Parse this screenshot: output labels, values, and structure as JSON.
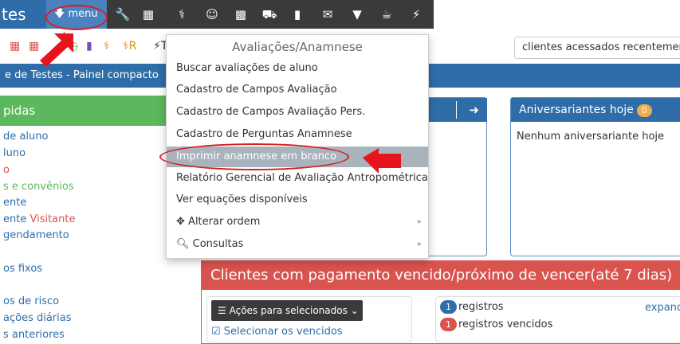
{
  "brand": {
    "title": "tes"
  },
  "topmenu": {
    "menu_label": "menu"
  },
  "row2": {
    "label_r": "R",
    "label_t": "T"
  },
  "search": {
    "value": "clientes acessados recentemente"
  },
  "bluebar": {
    "title": "e de Testes - Painel compacto"
  },
  "sidebar": {
    "header": "pidas",
    "items": [
      {
        "text": "de aluno",
        "color": "#2f6da8"
      },
      {
        "text": "luno",
        "color": "#2f6da8"
      },
      {
        "text": "o",
        "color": "#d9534f"
      },
      {
        "text": "s e convênios",
        "color": "#5cb85c"
      },
      {
        "text": "ente",
        "color": "#2f6da8"
      },
      {
        "text": "ente",
        "text2": "Visitante",
        "color": "#2f6da8",
        "color2": "#d9534f"
      },
      {
        "text": "gendamento",
        "color": "#2f6da8"
      },
      {
        "text": "os fixos",
        "color": "#2f6da8"
      },
      {
        "text": "os de risco",
        "color": "#2f6da8"
      },
      {
        "text": "ações diárias",
        "color": "#2f6da8"
      },
      {
        "text": "s anteriores",
        "color": "#2f6da8"
      }
    ]
  },
  "birthdays": {
    "title": "Aniversariantes hoje",
    "count": "0",
    "empty": "Nenhum aniversariante hoje"
  },
  "payments": {
    "title": "Clientes com pagamento vencido/próximo de vencer(até 7 dias)",
    "actions_label": "Ações para selecionados",
    "select_label": "Selecionar os vencidos",
    "reg_count": "1",
    "reg_label": "registros",
    "reg_venc_count": "1",
    "reg_venc_label": "registros vencidos",
    "expand_label": "expand"
  },
  "dropdown": {
    "header": "Avaliações/Anamnese",
    "items": [
      {
        "label": "Buscar avaliações de aluno"
      },
      {
        "label": "Cadastro de Campos Avaliação"
      },
      {
        "label": "Cadastro de Campos Avaliação Pers."
      },
      {
        "label": "Cadastro de Perguntas Anamnese"
      },
      {
        "label": "Imprimir anamnese em branco"
      },
      {
        "label": "Relatório Gerencial de Avaliação Antropométrica"
      },
      {
        "label": "Ver equações disponíveis"
      },
      {
        "label": "Alterar ordem"
      },
      {
        "label": "Consultas"
      }
    ]
  },
  "colors": {
    "primary": "#2f6da8",
    "success": "#5cb85c",
    "danger": "#d9534f",
    "warning": "#f0ad4e",
    "annotation": "#d81e1e"
  }
}
